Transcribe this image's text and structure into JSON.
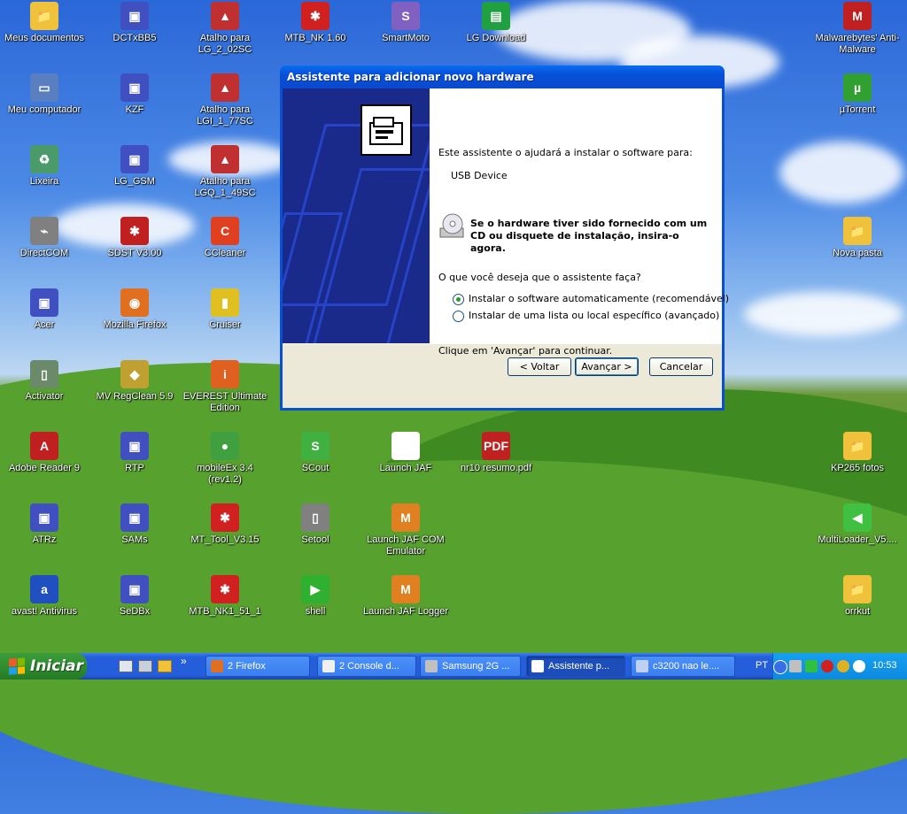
{
  "desktop": {
    "icons": [
      {
        "label": "Meus documentos",
        "color": "#f0c23c",
        "glyph": "📁"
      },
      {
        "label": "DCTxBB5",
        "color": "#4050c0",
        "glyph": "▣"
      },
      {
        "label": "Atalho para LG_2_02SC",
        "color": "#c03030",
        "glyph": "▲"
      },
      {
        "label": "MTB_NK 1.60",
        "color": "#d02020",
        "glyph": "✱"
      },
      {
        "label": "SmartMoto",
        "color": "#8060c0",
        "glyph": "S"
      },
      {
        "label": "LG Download",
        "color": "#20a040",
        "glyph": "▤"
      },
      {
        "label": "Malwarebytes' Anti-Malware",
        "color": "#c02020",
        "glyph": "M"
      },
      {
        "label": "Meu computador",
        "color": "#5a7fc0",
        "glyph": "▭"
      },
      {
        "label": "KZF",
        "color": "#4050c0",
        "glyph": "▣"
      },
      {
        "label": "Atalho para LGI_1_77SC",
        "color": "#c03030",
        "glyph": "▲"
      },
      {
        "label": "µTorrent",
        "color": "#30a030",
        "glyph": "µ"
      },
      {
        "label": "Lixeira",
        "color": "#4a9a6a",
        "glyph": "♻"
      },
      {
        "label": "LG_GSM",
        "color": "#4050c0",
        "glyph": "▣"
      },
      {
        "label": "Atalho para LGQ_1_49SC",
        "color": "#c03030",
        "glyph": "▲"
      },
      {
        "label": "DirectCOM",
        "color": "#808080",
        "glyph": "⌁"
      },
      {
        "label": "SDST V3.00",
        "color": "#c02020",
        "glyph": "✱"
      },
      {
        "label": "CCleaner",
        "color": "#e04020",
        "glyph": "C"
      },
      {
        "label": "Nova pasta",
        "color": "#f0c23c",
        "glyph": "📁"
      },
      {
        "label": "Acer",
        "color": "#4050c0",
        "glyph": "▣"
      },
      {
        "label": "Mozilla Firefox",
        "color": "#e07020",
        "glyph": "◉"
      },
      {
        "label": "Cruiser",
        "color": "#e0c020",
        "glyph": "▮"
      },
      {
        "label": "Activator",
        "color": "#6a8a6a",
        "glyph": "▯"
      },
      {
        "label": "MV RegClean 5.9",
        "color": "#c0a030",
        "glyph": "◆"
      },
      {
        "label": "EVEREST Ultimate Edition",
        "color": "#e06020",
        "glyph": "i"
      },
      {
        "label": "Adobe Reader 9",
        "color": "#c02020",
        "glyph": "A"
      },
      {
        "label": "RTP",
        "color": "#4050c0",
        "glyph": "▣"
      },
      {
        "label": "mobileEx 3.4 (rev1.2)",
        "color": "#40a040",
        "glyph": "●"
      },
      {
        "label": "SCout",
        "color": "#40b040",
        "glyph": "S"
      },
      {
        "label": "Launch JAF",
        "color": "#ffffff",
        "glyph": "J"
      },
      {
        "label": "nr10 resumo.pdf",
        "color": "#c02020",
        "glyph": "PDF"
      },
      {
        "label": "KP265 fotos",
        "color": "#f0c23c",
        "glyph": "📁"
      },
      {
        "label": "ATRz",
        "color": "#4050c0",
        "glyph": "▣"
      },
      {
        "label": "SAMs",
        "color": "#4050c0",
        "glyph": "▣"
      },
      {
        "label": "MT_Tool_V3.15",
        "color": "#d02020",
        "glyph": "✱"
      },
      {
        "label": "Setool",
        "color": "#808080",
        "glyph": "▯"
      },
      {
        "label": "Launch JAF COM Emulator",
        "color": "#e08020",
        "glyph": "M"
      },
      {
        "label": "MultiLoader_V5....",
        "color": "#40c040",
        "glyph": "◀"
      },
      {
        "label": "avast! Antivirus",
        "color": "#2050c0",
        "glyph": "a"
      },
      {
        "label": "SeDBx",
        "color": "#4050c0",
        "glyph": "▣"
      },
      {
        "label": "MTB_NK1_51_1",
        "color": "#d02020",
        "glyph": "✱"
      },
      {
        "label": "shell",
        "color": "#30b030",
        "glyph": "▶"
      },
      {
        "label": "Launch JAF Logger",
        "color": "#e08020",
        "glyph": "M"
      },
      {
        "label": "orrkut",
        "color": "#f0c23c",
        "glyph": "📁"
      }
    ]
  },
  "wizard": {
    "title": "Assistente para adicionar novo hardware",
    "intro": "Este assistente o ajudará a instalar o software para:",
    "device": "USB Device",
    "cd_hint": "Se o hardware tiver sido fornecido com um CD ou disquete de instalação, insira-o agora.",
    "question": "O que você deseja que o assistente faça?",
    "options": [
      {
        "label": "Instalar o software automaticamente (recomendável)",
        "selected": true
      },
      {
        "label": "Instalar de uma lista ou local específico (avançado)",
        "selected": false
      }
    ],
    "continue_text": "Clique em 'Avançar' para continuar.",
    "buttons": {
      "back": "< Voltar",
      "next": "Avançar >",
      "cancel": "Cancelar"
    }
  },
  "taskbar": {
    "start_label": "Iniciar",
    "chevron": "»",
    "items": [
      {
        "label": "2 Firefox",
        "icon_color": "#e07020"
      },
      {
        "label": "2 Console d...",
        "icon_color": "#f0f0f0"
      },
      {
        "label": "Samsung 2G ...",
        "icon_color": "#c0c0c0"
      },
      {
        "label": "Assistente p...",
        "icon_color": "#ffffff",
        "active": true
      },
      {
        "label": "c3200 nao le....",
        "icon_color": "#c0d0f0"
      }
    ],
    "language": "PT",
    "clock": "10:53"
  }
}
